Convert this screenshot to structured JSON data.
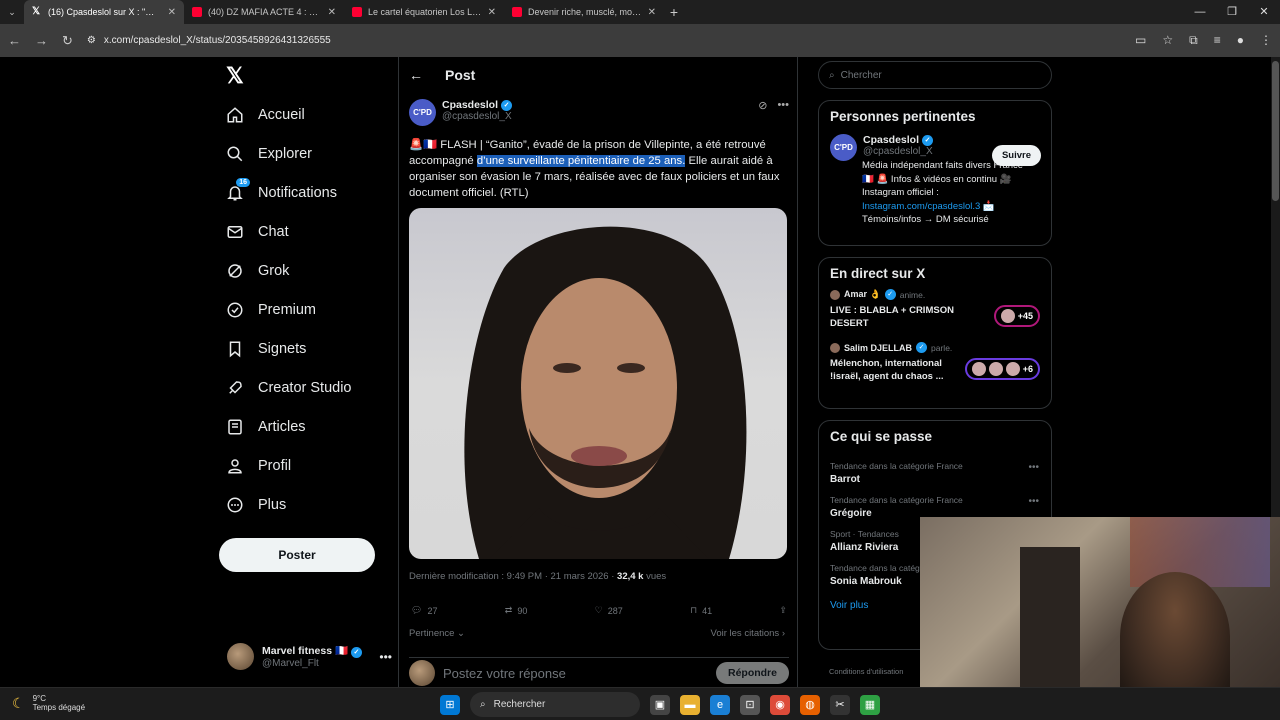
{
  "browser": {
    "tabs": [
      {
        "title": "(16) Cpasdeslol sur X : \"🚨🇫🇷 FLASH",
        "icon": "x-logo-icon",
        "active": true
      },
      {
        "title": "(40) DZ MAFIA ACTE 4 : DZ vs D...",
        "icon": "youtube-icon",
        "active": false
      },
      {
        "title": "Le cartel équatorien Los Lobos ...",
        "icon": "youtube-icon",
        "active": false
      },
      {
        "title": "Devenir riche, musclé, moins st...",
        "icon": "youtube-icon",
        "active": false
      }
    ],
    "url": "x.com/cpasdeslol_X/status/2035458926431326555"
  },
  "nav": {
    "items": [
      {
        "label": "Accueil",
        "icon": "home-icon"
      },
      {
        "label": "Explorer",
        "icon": "search-icon"
      },
      {
        "label": "Notifications",
        "icon": "bell-icon",
        "badge": "16"
      },
      {
        "label": "Chat",
        "icon": "mail-icon"
      },
      {
        "label": "Grok",
        "icon": "grok-icon"
      },
      {
        "label": "Premium",
        "icon": "premium-icon"
      },
      {
        "label": "Signets",
        "icon": "bookmark-icon"
      },
      {
        "label": "Creator Studio",
        "icon": "rocket-icon"
      },
      {
        "label": "Articles",
        "icon": "article-icon"
      },
      {
        "label": "Profil",
        "icon": "profile-icon"
      },
      {
        "label": "Plus",
        "icon": "more-circle-icon"
      }
    ],
    "post_button": "Poster",
    "account": {
      "name": "Marvel fitness 🇫🇷",
      "handle": "@Marvel_Flt"
    }
  },
  "post": {
    "header": "Post",
    "author_name": "Cpasdeslol",
    "author_handle": "@cpasdeslol_X",
    "avatar_text": "C'PAS DES LOL",
    "text_before": "🚨🇫🇷 FLASH | “Ganito”, évadé de la prison de Villepinte, a été retrouvé accompagné ",
    "text_highlight": "d’une surveillante pénitentiaire de 25 ans.",
    "text_after": " Elle aurait aidé à organiser son évasion le 7 mars, réalisée avec de faux policiers et un faux document officiel. (RTL)",
    "meta_label": "Dernière modification : 9:49 PM · 21 mars 2026 · ",
    "views": "32,4 k",
    "views_label": " vues",
    "replies": "27",
    "reposts": "90",
    "likes": "287",
    "bookmarks": "41",
    "relevance": "Pertinence",
    "see_quotes": "Voir les citations",
    "reply_placeholder": "Postez votre réponse",
    "reply_button": "Répondre"
  },
  "sidebar": {
    "search_placeholder": "Chercher",
    "relevant": {
      "title": "Personnes pertinentes",
      "name": "Cpasdeslol",
      "handle": "@cpasdeslol_X",
      "follow": "Suivre",
      "bio_1": "Média indépendant faits divers France",
      "bio_2": "🇫🇷 🚨 Infos & vidéos en continu 🎥",
      "bio_3": "Instagram officiel :",
      "bio_link": "Instagram.com/cpasdeslol.3",
      "bio_4": "Témoins/infos → DM sécurisé"
    },
    "live": {
      "title": "En direct sur X",
      "items": [
        {
          "host": "Amar 👌",
          "action": "anime.",
          "title": "LIVE : BLABLA + CRIMSON DESERT",
          "count": "+45"
        },
        {
          "host": "Salim DJELLAB",
          "action": "parle.",
          "title": "Mélenchon, international !israël, agent du chaos ...",
          "count": "+6"
        }
      ]
    },
    "trends": {
      "title": "Ce qui se passe",
      "items": [
        {
          "category": "Tendance dans la catégorie France",
          "name": "Barrot"
        },
        {
          "category": "Tendance dans la catégorie France",
          "name": "Grégoire"
        },
        {
          "category": "Sport · Tendances",
          "name": "Allianz Riviera"
        },
        {
          "category": "Tendance dans la catég",
          "name": "Sonia Mabrouk"
        }
      ],
      "see_more": "Voir plus"
    },
    "footer": "Conditions d'utilisation"
  },
  "taskbar": {
    "temp": "9°C",
    "weather": "Temps dégagé",
    "search": "Rechercher"
  },
  "colors": {
    "accent": "#1d9bf0",
    "highlight": "#1c5fb8",
    "background": "#000000"
  }
}
